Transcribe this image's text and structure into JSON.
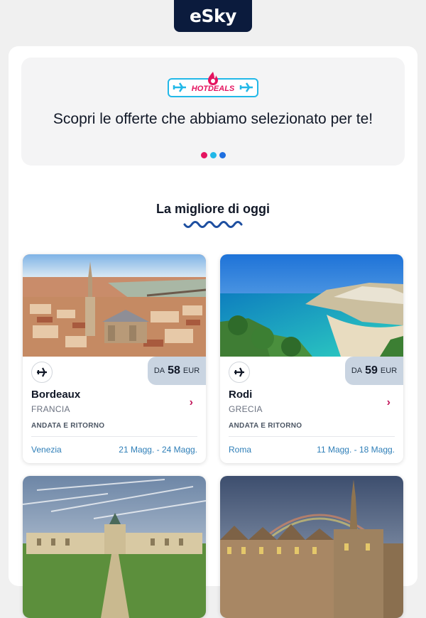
{
  "brand": {
    "logo_text": "eSky",
    "logo_bg": "#0b1b3d"
  },
  "hero": {
    "badge_label": "HOTDEALS",
    "badge_icons": [
      "flame-icon",
      "plane-icon"
    ],
    "title": "Scopri le offerte che abbiamo selezionato per te!",
    "dot_colors": [
      "#e4145f",
      "#22b8e8",
      "#1e6fe0"
    ]
  },
  "section": {
    "title": "La migliore di oggi"
  },
  "offers": [
    {
      "city": "Bordeaux",
      "country": "FRANCIA",
      "price_prefix": "DA",
      "price": "58",
      "currency": "EUR",
      "trip_type": "ANDATA E RITORNO",
      "from": "Venezia",
      "dates": "21 Magg. - 24 Magg.",
      "icon": "plane-icon",
      "chevron": "›"
    },
    {
      "city": "Rodi",
      "country": "GRECIA",
      "price_prefix": "DA",
      "price": "59",
      "currency": "EUR",
      "trip_type": "ANDATA E RITORNO",
      "from": "Roma",
      "dates": "11 Magg. - 18 Magg.",
      "icon": "plane-icon",
      "chevron": "›"
    }
  ],
  "colors": {
    "accent": "#c2185b",
    "link": "#2f7fb8",
    "price_bg": "#c9d4e1"
  }
}
